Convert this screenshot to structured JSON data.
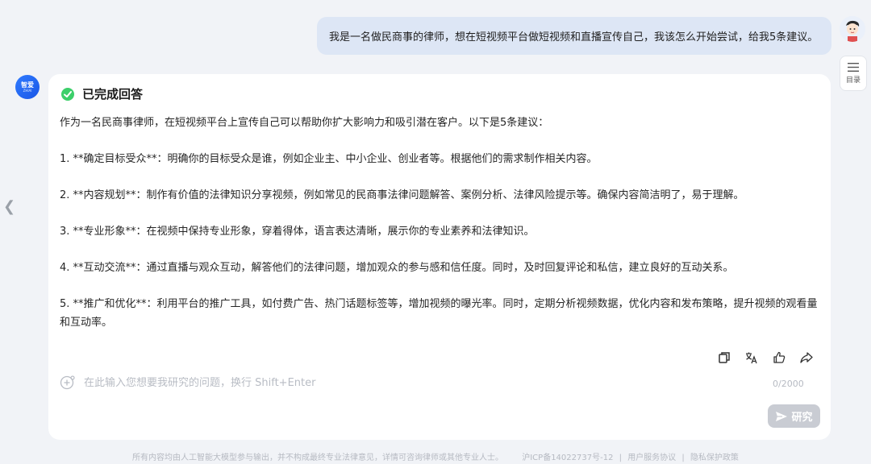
{
  "user_message": "我是一名做民商事的律师，想在短视频平台做短视频和直播宣传自己，我该怎么开始尝试，给我5条建议。",
  "toc": {
    "label": "目录",
    "icon": "list-icon"
  },
  "bot": {
    "avatar_text": "智爱",
    "avatar_subtext": "ZHIAI"
  },
  "answer": {
    "status": "已完成回答",
    "paragraphs": [
      "作为一名民商事律师，在短视频平台上宣传自己可以帮助你扩大影响力和吸引潜在客户。以下是5条建议：",
      "1. **确定目标受众**：明确你的目标受众是谁，例如企业主、中小企业、创业者等。根据他们的需求制作相关内容。",
      "2. **内容规划**：制作有价值的法律知识分享视频，例如常见的民商事法律问题解答、案例分析、法律风险提示等。确保内容简洁明了，易于理解。",
      "3. **专业形象**：在视频中保持专业形象，穿着得体，语言表达清晰，展示你的专业素养和法律知识。",
      "4. **互动交流**：通过直播与观众互动，解答他们的法律问题，增加观众的参与感和信任度。同时，及时回复评论和私信，建立良好的互动关系。",
      "5. **推广和优化**：利用平台的推广工具，如付费广告、热门话题标签等，增加视频的曝光率。同时，定期分析视频数据，优化内容和发布策略，提升视频的观看量和互动率。"
    ]
  },
  "actions": [
    "copy-icon",
    "translate-icon",
    "thumbs-up-icon",
    "share-icon"
  ],
  "input": {
    "placeholder": "在此输入您想要我研究的问题，换行 Shift+Enter",
    "value": "",
    "char_count": "0/2000"
  },
  "send_button": {
    "label": "研究",
    "icon": "send-icon"
  },
  "footer": {
    "disclaimer": "所有内容均由人工智能大模型参与输出，并不构成最终专业法律意见，详情可咨询律师或其他专业人士。",
    "icp": "沪ICP备14022737号-12",
    "agreement": "用户服务协议",
    "privacy": "隐私保护政策",
    "sep": "|"
  }
}
